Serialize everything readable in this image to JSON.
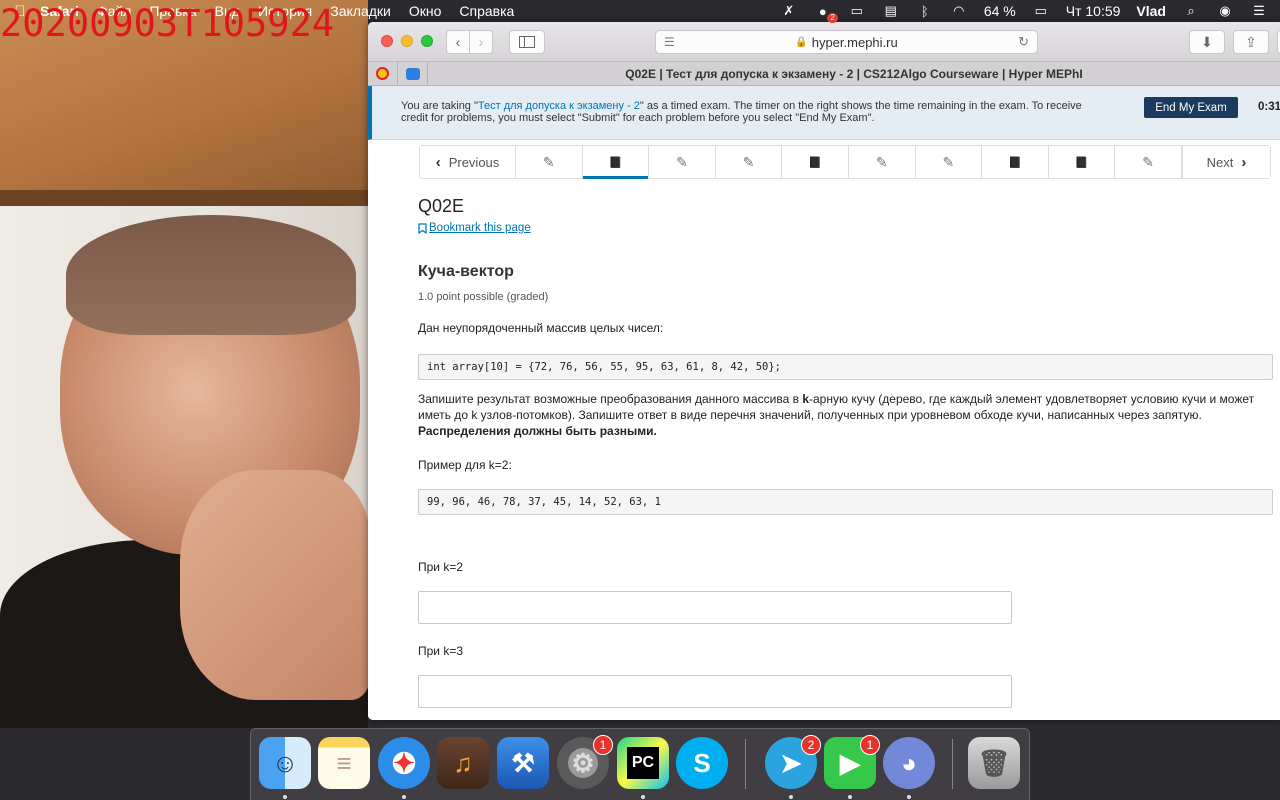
{
  "webcam": {
    "timestamp": "20200903T105924"
  },
  "menubar": {
    "app_name": "Safari",
    "menus": [
      "Файл",
      "Правка",
      "Вид",
      "История",
      "Закладки",
      "Окно",
      "Справка"
    ],
    "notification_badge": "2",
    "battery": "64 %",
    "clock": "Чт 10:59",
    "user": "Vlad"
  },
  "safari": {
    "address": "hyper.mephi.ru",
    "tab_title": "Q02E | Тест для допуска к экзамену - 2 | CS212Algo Courseware | Hyper MEPhI"
  },
  "exam_banner": {
    "prefix": "You are taking \"",
    "exam_link": "Тест для допуска к экзамену - 2",
    "suffix": "\" as a timed exam. The timer on the right shows the time remaining in the exam. To receive credit for problems, you must select \"Submit\" for each problem before you select \"End My Exam\".",
    "end_button": "End My Exam",
    "timer": "0:31:"
  },
  "sequence_nav": {
    "previous": "Previous",
    "next": "Next",
    "units": [
      {
        "icon": "✎",
        "kind": "problem"
      },
      {
        "icon": "📘",
        "kind": "reading",
        "active": true
      },
      {
        "icon": "✎",
        "kind": "problem"
      },
      {
        "icon": "✎",
        "kind": "problem"
      },
      {
        "icon": "📘",
        "kind": "reading"
      },
      {
        "icon": "✎",
        "kind": "problem"
      },
      {
        "icon": "✎",
        "kind": "problem"
      },
      {
        "icon": "📘",
        "kind": "reading"
      },
      {
        "icon": "📘",
        "kind": "reading"
      },
      {
        "icon": "✎",
        "kind": "problem"
      }
    ]
  },
  "unit": {
    "title": "Q02E",
    "bookmark": "Bookmark this page"
  },
  "problem": {
    "title": "Куча-вектор",
    "points": "1.0 point possible (graded)",
    "intro": "Дан неупорядоченный массив целых чисел:",
    "code_array": "int array[10] = {72, 76, 56, 55, 95, 63, 61, 8, 42, 50};",
    "task_part1": "Запишите результат возможные преобразования данного массива в ",
    "task_bold_k": "k",
    "task_part2": "-арную кучу (дерево, где каждый элемент удовлетворяет условию кучи и может иметь до k узлов-потомков). Запишите ответ в виде перечня значений, полученных при уровневом обходе кучи, написанных через запятую. ",
    "task_bold_end": "Распределения должны быть разными.",
    "example_label": "Пример для k=2:",
    "code_example": "99, 96, 46, 78, 37, 45, 14, 52, 63, 1",
    "answer_k2_label": "При k=2",
    "answer_k3_label": "При k=3"
  },
  "dock": {
    "apps": [
      {
        "name": "finder",
        "badge": ""
      },
      {
        "name": "notes",
        "badge": ""
      },
      {
        "name": "safari",
        "badge": ""
      },
      {
        "name": "garageband",
        "badge": ""
      },
      {
        "name": "xcode",
        "badge": ""
      },
      {
        "name": "system-preferences",
        "badge": "1"
      },
      {
        "name": "pycharm",
        "badge": ""
      },
      {
        "name": "skype",
        "badge": ""
      },
      {
        "name": "telegram",
        "badge": "2"
      },
      {
        "name": "facetime",
        "badge": "1"
      },
      {
        "name": "discord",
        "badge": ""
      },
      {
        "name": "trash",
        "badge": ""
      }
    ],
    "pycharm_label": "PC"
  }
}
